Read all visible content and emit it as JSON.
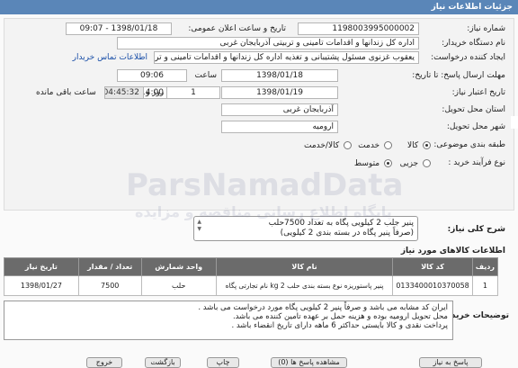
{
  "window": {
    "title": "جزئیات اطلاعات نیاز"
  },
  "form": {
    "need_number_label": "شماره نیاز:",
    "need_number": "1198003995000002",
    "announce_label": "تاریخ و ساعت اعلان عمومی:",
    "announce_value": "1398/01/18 - 09:07",
    "buyer_label": "نام دستگاه خریدار:",
    "buyer_value": "اداره کل زندانها و اقدامات تامینی و تربیتی آذربایجان غربی",
    "creator_label": "ایجاد کننده درخواست:",
    "creator_value": "یعقوب غزنوی مسئول پشتیبانی و تغذیه اداره کل زندانها و اقدامات تامینی و تربیتی آذربایجان غربی",
    "contact_link": "اطلاعات تماس خریدار",
    "send_deadline_label": "مهلت ارسال پاسخ: تا تاریخ:",
    "send_date": "1398/01/18",
    "time_label": "ساعت",
    "send_time": "09:06",
    "validity_label": "تاریخ اعتبار نیاز:",
    "validity_date": "1398/01/19",
    "validity_time": "14:00",
    "days_value": "1",
    "days_label": "روز و",
    "remaining_time": "04:45:32",
    "remaining_label": "ساعت باقی مانده",
    "province_label": "استان محل تحویل:",
    "province_value": "آذربایجان غربی",
    "city_label": "شهر محل تحویل:",
    "city_value": "ارومیه",
    "category_label": "طبقه بندی موضوعی:",
    "category_options": [
      "کالا",
      "خدمت",
      "کالا/خدمت"
    ],
    "process_label": "نوع فرآیند خرید :",
    "process_options": [
      "جزیی",
      "متوسط"
    ]
  },
  "need_summary": {
    "label": "شرح کلی نیاز:",
    "line1": "پنیر جلب 2 کیلویی پگاه به تعداد 7500حلب",
    "line2": "(صرفاً پنیر پگاه در بسته بندی 2 کیلویی)"
  },
  "goods": {
    "title": "اطلاعات کالاهای مورد نیاز",
    "columns": [
      "ردیف",
      "کد کالا",
      "نام کالا",
      "واحد شمارش",
      "تعداد / مقدار",
      "تاریخ نیاز"
    ],
    "rows": [
      [
        "1",
        "0133400010370058",
        "پنیر پاستوریزه نوع بسته بندی حلب 2 kg نام تجارتی پگاه",
        "حلب",
        "7500",
        "1398/01/27"
      ]
    ]
  },
  "buyer_notes": {
    "label": "توضیحات خریدار:",
    "lines": [
      "ایران کد مشابه می باشد و صرفاً پنیر 2 کیلویی پگاه مورد درخواست می باشد .",
      "محل تحویل ارومیه بوده و هزینه حمل بر عهده تامین کننده می باشد.",
      "پرداخت نقدی و کالا بایستی حداکثر 6 ماهه دارای تاریخ انقضاء باشد ."
    ]
  },
  "buttons": {
    "reply": "پاسخ به نیاز",
    "view_replies": "مشاهده پاسخ ها (0)",
    "print": "چاپ",
    "back": "بازگشت",
    "exit": "خروج"
  },
  "watermark": {
    "main": "ParsNamadData",
    "sub": "پایگاه اطلاع رسانی مناقصه و مزایده"
  }
}
